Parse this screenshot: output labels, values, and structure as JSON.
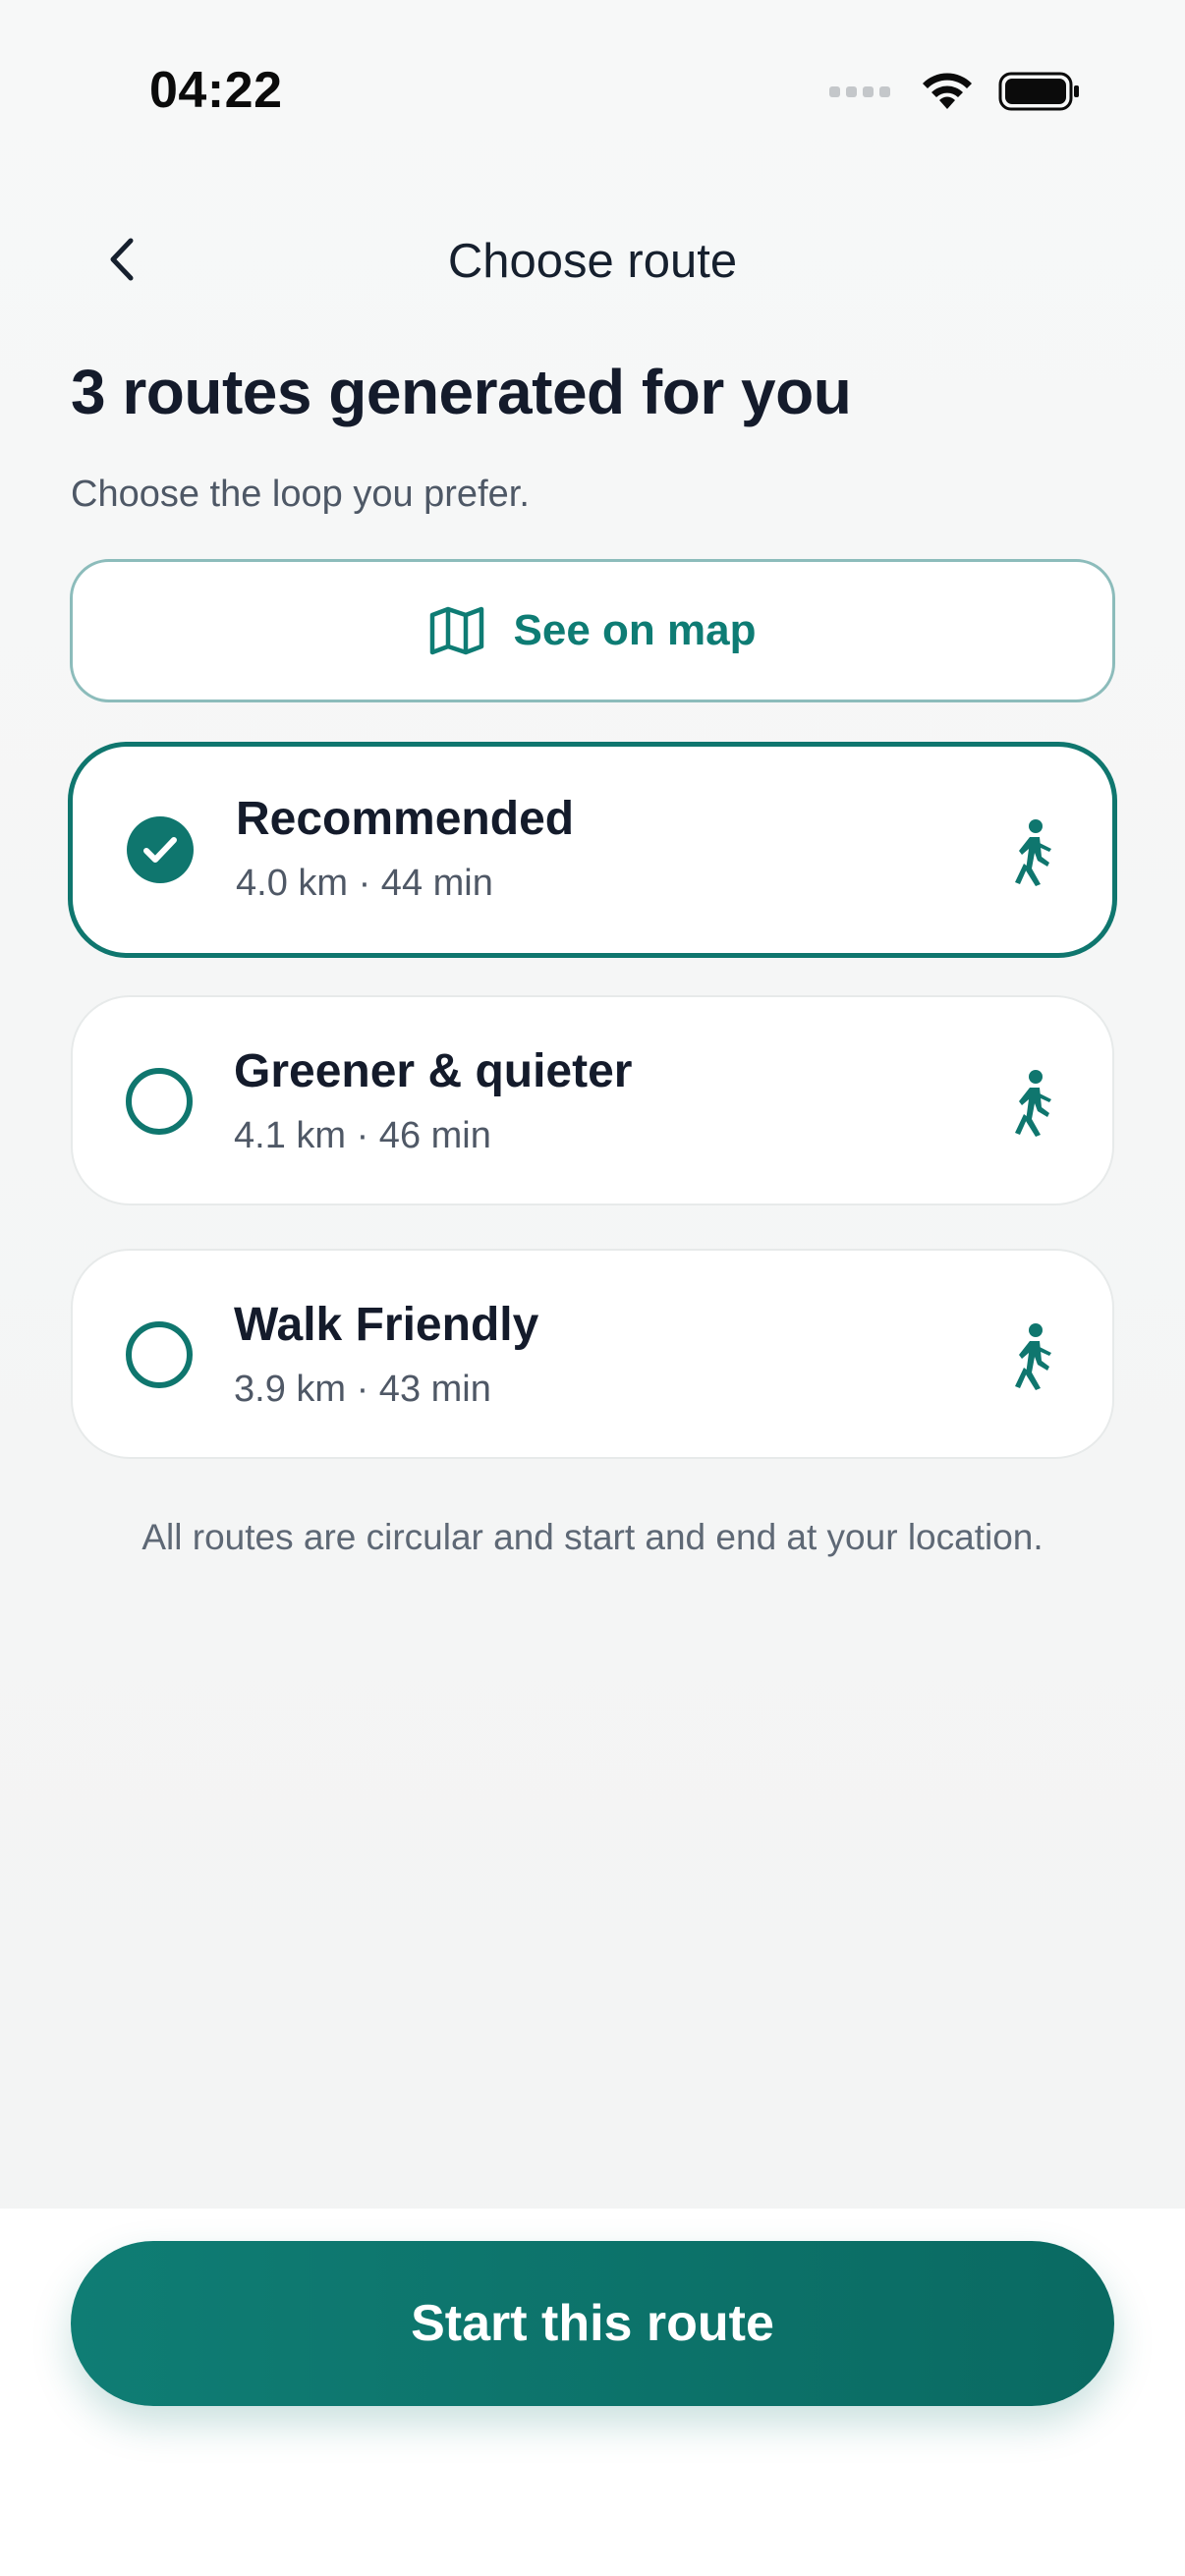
{
  "status_bar": {
    "time": "04:22"
  },
  "header": {
    "title": "Choose route"
  },
  "heading": "3 routes generated for you",
  "subtitle": "Choose the loop you prefer.",
  "map_button": {
    "label": "See on map",
    "icon": "map-icon"
  },
  "routes": [
    {
      "name": "Recommended",
      "meta": "4.0 km · 44 min",
      "selected": true,
      "icon": "walking-icon"
    },
    {
      "name": "Greener & quieter",
      "meta": "4.1 km · 46 min",
      "selected": false,
      "icon": "walking-icon"
    },
    {
      "name": "Walk Friendly",
      "meta": "3.9 km · 43 min",
      "selected": false,
      "icon": "walking-icon"
    }
  ],
  "footnote": "All routes are circular and start and end at your location.",
  "start_button": {
    "label": "Start this route"
  },
  "colors": {
    "accent": "#0f766e",
    "text": "#141b2b",
    "muted": "#4f5866"
  }
}
